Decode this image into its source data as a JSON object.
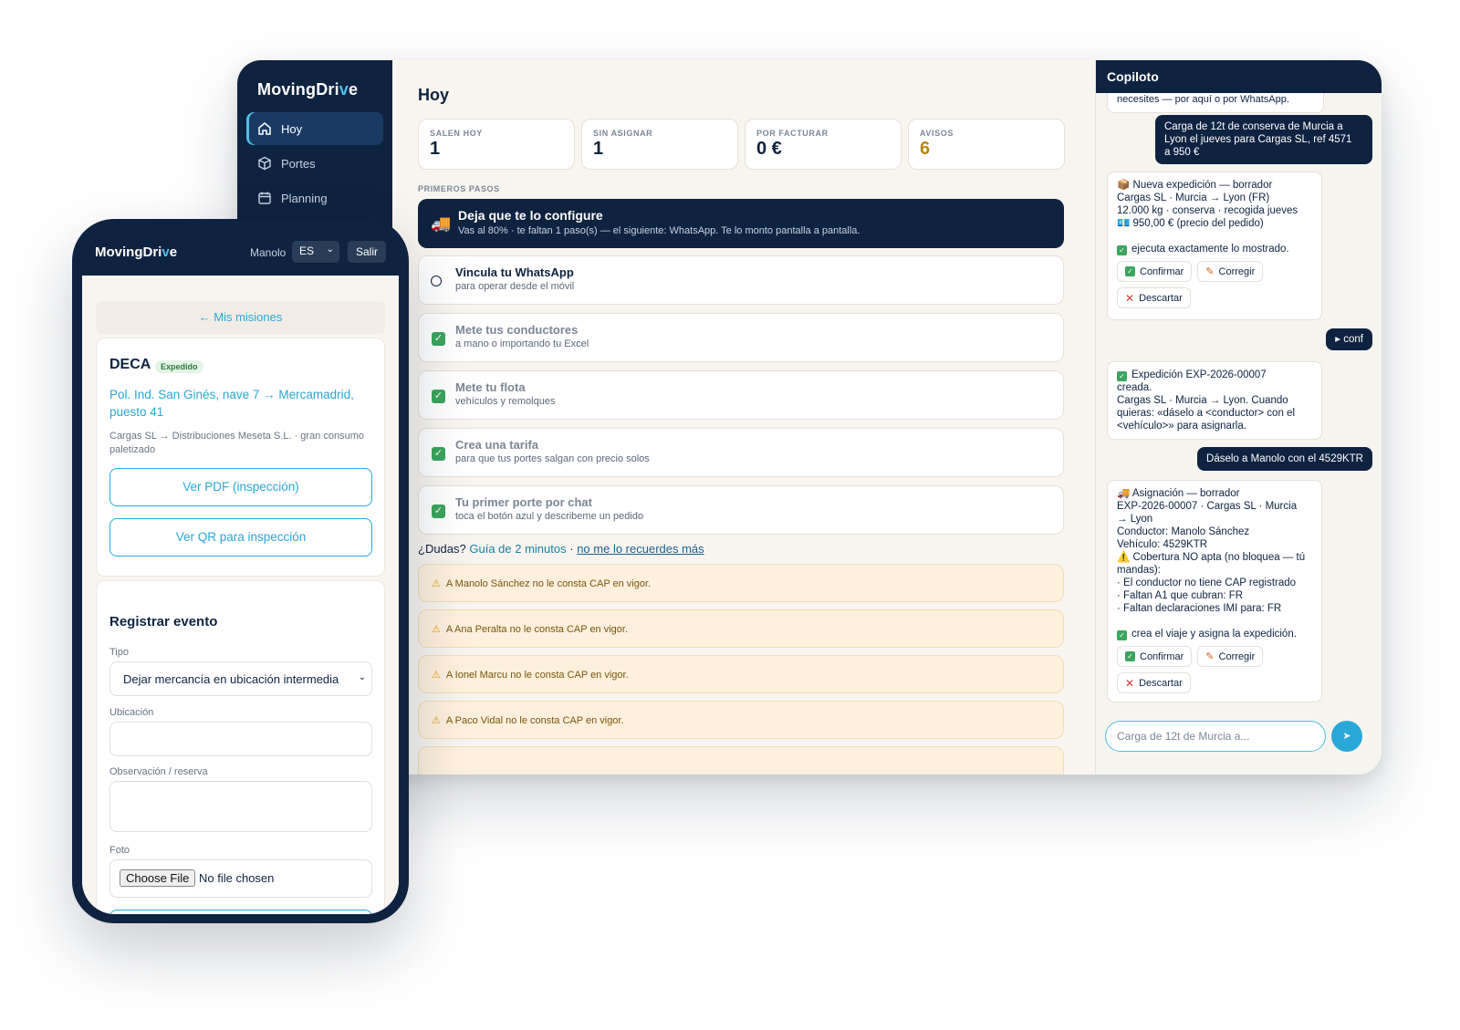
{
  "desktop": {
    "brand": {
      "prefix": "MovingDri",
      "v": "v",
      "suffix": "e"
    },
    "nav": [
      {
        "label": "Hoy",
        "icon": "home-icon",
        "active": true
      },
      {
        "label": "Portes",
        "icon": "box-icon",
        "active": false
      },
      {
        "label": "Planning",
        "icon": "calendar-icon",
        "active": false
      }
    ],
    "main": {
      "title": "Hoy",
      "stats": [
        {
          "label": "SALEN HOY",
          "value": "1"
        },
        {
          "label": "SIN ASIGNAR",
          "value": "1"
        },
        {
          "label": "POR FACTURAR",
          "value": "0 €"
        },
        {
          "label": "AVISOS",
          "value": "6"
        }
      ],
      "section_label": "PRIMEROS PASOS",
      "banner": {
        "title": "Deja que te lo configure",
        "sub": "Vas al 80% · te faltan 1 paso(s) — el siguiente: WhatsApp. Te lo monto pantalla a pantalla."
      },
      "steps": [
        {
          "title": "Vincula tu WhatsApp",
          "sub": "para operar desde el móvil",
          "done": false
        },
        {
          "title": "Mete tus conductores",
          "sub": "a mano o importando tu Excel",
          "done": true
        },
        {
          "title": "Mete tu flota",
          "sub": "vehículos y remolques",
          "done": true
        },
        {
          "title": "Crea una tarifa",
          "sub": "para que tus portes salgan con precio solos",
          "done": true
        },
        {
          "title": "Tu primer porte por chat",
          "sub": "toca el botón azul y describeme un pedido",
          "done": true
        }
      ],
      "doubts": {
        "prefix": "¿Dudas?",
        "guide": "Guía de 2 minutos",
        "sep": "·",
        "dismiss": "no me lo recuerdes más"
      },
      "alerts": [
        "A Manolo Sánchez no le consta CAP en vigor.",
        "A Ana Peralta no le consta CAP en vigor.",
        "A Ionel Marcu no le consta CAP en vigor.",
        "A Paco Vidal no le consta CAP en vigor."
      ]
    },
    "copilot": {
      "title": "Copiloto",
      "cutoff_text": "necesites — por aquí o por WhatsApp.",
      "user_msg_1": [
        "Carga de 12t de conserva de Murcia a",
        "Lyon el jueves para Cargas SL, ref 4571",
        "a 950 €"
      ],
      "bot_msg_1": {
        "lines": [
          "📦 Nueva expedición — borrador",
          "Cargas SL · Murcia → Lyon (FR)",
          "12.000 kg · conserva · recogida jueves",
          "💶 950,00 € (precio del pedido)"
        ],
        "note": "ejecuta exactamente lo mostrado."
      },
      "user_msg_2": "▸ conf",
      "bot_msg_2": [
        "Expedición EXP-2026-00007",
        "creada.",
        "Cargas SL · Murcia → Lyon. Cuando",
        "quieras: «dáselo a <conductor> con el",
        "<vehículo>» para asignarla."
      ],
      "user_msg_3": "Dáselo a Manolo con el 4529KTR",
      "bot_msg_3": {
        "lines": [
          "🚚 Asignación — borrador",
          "EXP-2026-00007 · Cargas SL · Murcia",
          "→ Lyon",
          "Conductor: Manolo Sánchez",
          "Vehículo: 4529KTR",
          "⚠️ Cobertura NO apta (no bloquea — tú",
          "mandas):",
          " · El conductor no tiene CAP registrado",
          " · Faltan A1 que cubran: FR",
          " · Faltan declaraciones IMI para: FR"
        ],
        "note": "crea el viaje y asigna la expedición."
      },
      "buttons": {
        "confirm": "Confirmar",
        "fix": "Corregir",
        "discard": "Descartar"
      },
      "input_placeholder": "Carga de 12t de Murcia a...",
      "send": "➤"
    }
  },
  "phone": {
    "brand": {
      "prefix": "MovingDri",
      "v": "v",
      "suffix": "e"
    },
    "user": "Manolo",
    "lang": "ES",
    "logout": "Salir",
    "back": "← Mis misiones",
    "mission": {
      "code": "DECA",
      "status": "Expedido",
      "route": "Pol. Ind. San Ginés, nave 7 → Mercamadrid, puesto 41",
      "detail": "Cargas SL → Distribuciones Meseta S.L. · gran consumo paletizado",
      "pdf_btn": "Ver PDF (inspección)",
      "qr_btn": "Ver QR para inspección"
    },
    "form": {
      "title": "Registrar evento",
      "tipo_label": "Tipo",
      "tipo_value": "Dejar mercancía en ubicación intermedia",
      "ubicacion_label": "Ubicación",
      "obs_label": "Observación / reserva",
      "foto_label": "Foto",
      "file_btn": "Choose File",
      "file_status": "No file chosen"
    }
  },
  "colors": {
    "navy": "#0e2340",
    "accent": "#2aa7d6",
    "cream": "#f8f5f0",
    "warn_bg": "#fdf0dc",
    "success": "#3ba55d"
  }
}
